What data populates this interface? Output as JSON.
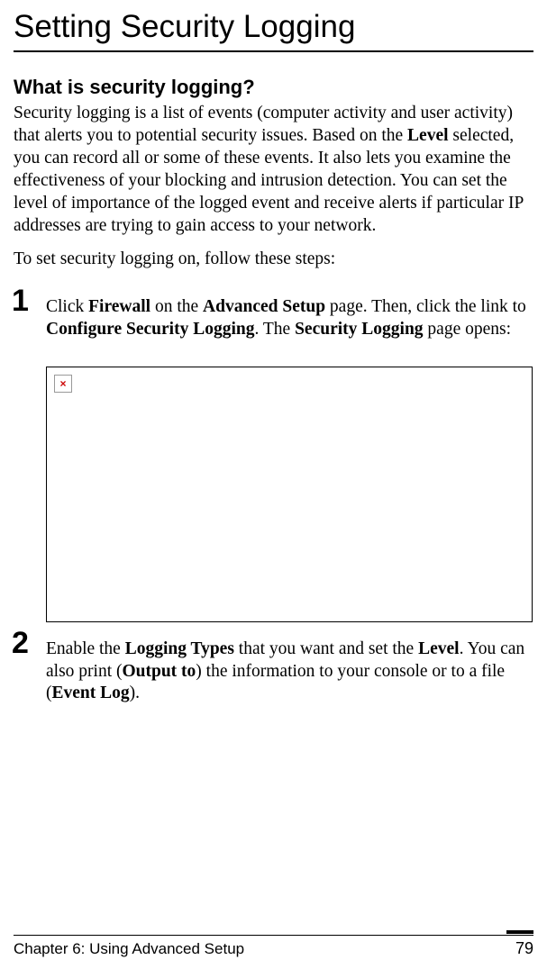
{
  "title": "Setting Security Logging",
  "sectionHeading": "What is security logging?",
  "intro": {
    "text_a": "Security logging is a list of events (computer activity and user activity) that alerts you to potential security issues. Based on the ",
    "bold_a": "Level",
    "text_b": " selected, you can record all or some of these events. It also lets you examine the effectiveness of your blocking and intrusion detection. You can set the level of importance of the logged event and receive alerts if particular IP addresses are trying to gain access to your network."
  },
  "leadIn": "To set security logging on, follow these steps:",
  "step1": {
    "num": "1",
    "t1": "Click ",
    "b1": "Firewall",
    "t2": " on the ",
    "b2": "Advanced Setup",
    "t3": " page. Then, click the link to ",
    "b3": "Configure Security Logging",
    "t4": ". The ",
    "b4": "Security Logging",
    "t5": " page opens:"
  },
  "brokenGlyph": "×",
  "step2": {
    "num": "2",
    "t1": "Enable the ",
    "b1": "Logging Types",
    "t2": " that you want and set the ",
    "b2": "Level",
    "t3": ". You can also print (",
    "b3": "Output to",
    "t4": ") the information to your console or to a file (",
    "b4": "Event Log",
    "t5": ")."
  },
  "footer": {
    "chapter": "Chapter 6: Using Advanced Setup",
    "page": "79"
  }
}
